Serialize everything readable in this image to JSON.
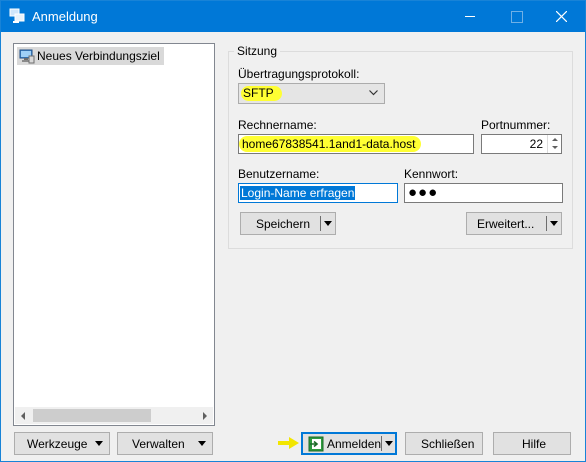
{
  "window": {
    "title": "Anmeldung",
    "app_icon": "winscp-icon",
    "controls": [
      "minimize-icon",
      "maximize-icon",
      "close-icon"
    ]
  },
  "site_tree": {
    "items": [
      {
        "label": "Neues Verbindungsziel",
        "icon": "computer-icon",
        "selected": true
      }
    ]
  },
  "session": {
    "group_label": "Sitzung",
    "protocol_label": "Übertragungsprotokoll:",
    "protocol_value": "SFTP",
    "host_label": "Rechnername:",
    "host_value": "home67838541.1and1-data.host",
    "port_label": "Portnummer:",
    "port_value": "22",
    "user_label": "Benutzername:",
    "user_value": "Login-Name erfragen",
    "password_label": "Kennwort:",
    "password_value": "●●●",
    "save_label": "Speichern",
    "advanced_label": "Erweitert..."
  },
  "footer": {
    "tools_label": "Werkzeuge",
    "manage_label": "Verwalten",
    "login_label": "Anmelden",
    "close_label": "Schließen",
    "help_label": "Hilfe"
  },
  "colors": {
    "titlebar": "#0078d7",
    "highlight": "#ffff33",
    "selection": "#0078d7"
  }
}
